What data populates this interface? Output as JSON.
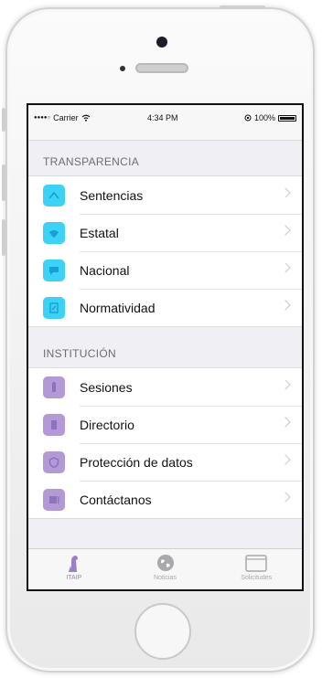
{
  "status_bar": {
    "carrier": "Carrier",
    "time": "4:34 PM",
    "battery": "100%",
    "signal_dots": "●●●●○"
  },
  "sections": [
    {
      "header": "TRANSPARENCIA",
      "accent": "#3bd2f5",
      "items": [
        {
          "label": "Sentencias",
          "icon": "sentencias-icon"
        },
        {
          "label": "Estatal",
          "icon": "estatal-icon"
        },
        {
          "label": "Nacional",
          "icon": "nacional-icon"
        },
        {
          "label": "Normatividad",
          "icon": "normatividad-icon"
        }
      ]
    },
    {
      "header": "INSTITUCIÓN",
      "accent": "#b39ad6",
      "items": [
        {
          "label": "Sesiones",
          "icon": "sesiones-icon"
        },
        {
          "label": "Directorio",
          "icon": "directorio-icon"
        },
        {
          "label": "Protección de datos",
          "icon": "shield-icon"
        },
        {
          "label": "Contáctanos",
          "icon": "contact-icon"
        }
      ]
    }
  ],
  "tab_bar": {
    "tabs": [
      {
        "label": "ITAIP",
        "icon": "itaip-icon",
        "active": true
      },
      {
        "label": "Noticias",
        "icon": "globe-icon",
        "active": false
      },
      {
        "label": "Solicitudes",
        "icon": "inbox-icon",
        "active": false
      }
    ],
    "active_color": "#9b7fc7",
    "inactive_color": "#a8a8ad"
  }
}
